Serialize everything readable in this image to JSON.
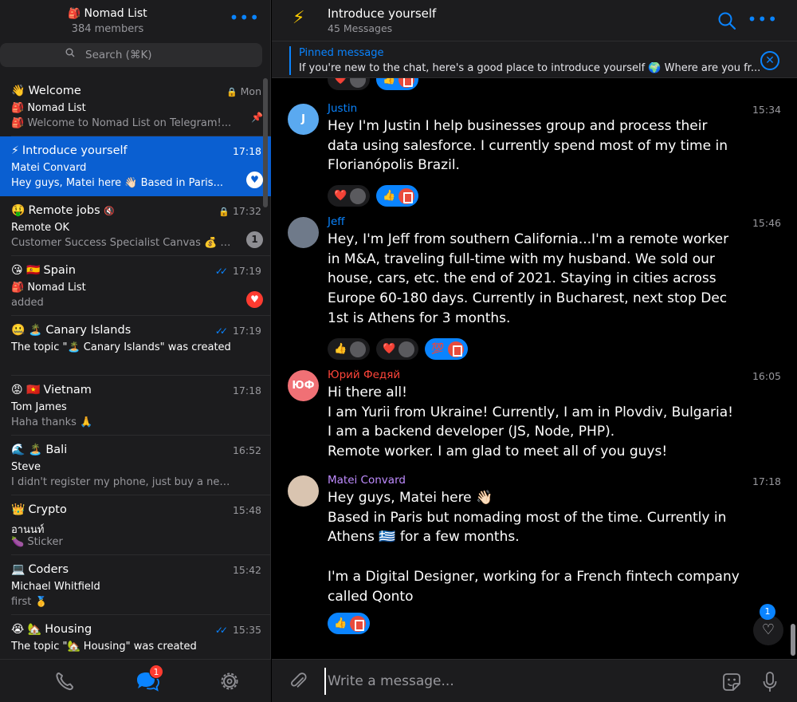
{
  "group": {
    "icon": "backpack-icon",
    "title": "Nomad List",
    "members": "384 members"
  },
  "search": {
    "placeholder": "Search (⌘K)"
  },
  "chats": [
    {
      "emoji": "👋",
      "name": "Welcome",
      "time": "Mon",
      "locked": true,
      "line2": "🎒 Nomad List",
      "line3": "🎒 Welcome to Nomad List on Telegram!...",
      "side": "pin"
    },
    {
      "emoji": "⚡",
      "name": "Introduce yourself",
      "time": "17:18",
      "active": true,
      "line2": "Matei Convard",
      "line3": "Hey guys, Matei here 👋🏻 Based in Paris...",
      "side": "heart-white"
    },
    {
      "emoji": "🤑",
      "name": "Remote jobs",
      "muted": true,
      "time": "17:32",
      "locked": true,
      "line2": "Remote OK",
      "line3": "Customer Success Specialist Canvas 💰 ~$...",
      "side": "count",
      "count": "1"
    },
    {
      "emoji": "😘 🇪🇸",
      "name": "Spain",
      "time": "17:19",
      "read": true,
      "line2": "🎒 Nomad List",
      "line3": "added",
      "side": "heart-red"
    },
    {
      "emoji": "🤐 🏝️",
      "name": "Canary Islands",
      "time": "17:19",
      "read": true,
      "line2": "The topic \"🏝️ Canary Islands\" was created",
      "line3": ""
    },
    {
      "emoji": "😡 🇻🇳",
      "name": "Vietnam",
      "time": "17:18",
      "line2": "Tom James",
      "line3": "Haha thanks 🙏"
    },
    {
      "emoji": "🌊 🏝️",
      "name": "Bali",
      "time": "16:52",
      "line2": "Steve",
      "line3": "I didn't register my phone, just buy a new sim c..."
    },
    {
      "emoji": "👑",
      "name": "Crypto",
      "time": "15:48",
      "line2": "อานนท์",
      "line3": "🍆 Sticker"
    },
    {
      "emoji": "💻",
      "name": "Coders",
      "time": "15:42",
      "line2": "Michael Whitfield",
      "line3": "first 🥇"
    },
    {
      "emoji": "😭 🏡",
      "name": "Housing",
      "time": "15:35",
      "read": true,
      "line2": "The topic \"🏡 Housing\" was created",
      "line3": ""
    }
  ],
  "tabbar": {
    "chats_badge": "1"
  },
  "topic": {
    "icon": "lightning-icon",
    "title": "Introduce yourself",
    "subtitle": "45 Messages"
  },
  "pinned": {
    "title": "Pinned message",
    "text": "If you're new to the chat, here's a good place to introduce yourself  🌍  Where are you fr..."
  },
  "messages": [
    {
      "sender": "Justin",
      "sender_color": "#0a84ff",
      "time": "15:34",
      "avatar_initials": "J",
      "avatar_color": "#5aa9f0",
      "text": "Hey I'm Justin I help businesses group and process their data using salesforce. I currently spend most of my time in Florianópolis Brazil.",
      "reactions": [
        {
          "emoji": "❤️",
          "mine": false
        },
        {
          "emoji": "👍",
          "mine": true
        }
      ]
    },
    {
      "sender": "Jeff",
      "sender_color": "#0a84ff",
      "time": "15:46",
      "avatar_initials": "",
      "avatar_color": "#6f7a8a",
      "text": "Hey, I'm Jeff from southern California...I'm a remote worker in M&A,  traveling full-time with my husband. We sold our house, cars, etc. the end of 2021. Staying in cities across Europe 60-180 days. Currently in Bucharest, next stop Dec 1st is Athens for 3 months.",
      "reactions": [
        {
          "emoji": "👍",
          "mine": false
        },
        {
          "emoji": "❤️",
          "mine": false
        },
        {
          "emoji": "💯",
          "mine": true
        }
      ]
    },
    {
      "sender": "Юрий Федяй",
      "sender_color": "#ff453a",
      "time": "16:05",
      "avatar_initials": "ЮФ",
      "avatar_color": "#f07075",
      "text": "Hi there all!\n I am Yurii from Ukraine! Currently, I am in Plovdiv, Bulgaria!\nI am a backend developer (JS, Node, PHP).\nRemote worker. I am glad to meet all of you guys!",
      "reactions": []
    },
    {
      "sender": "Matei Convard",
      "sender_color": "#bf8cff",
      "time": "17:18",
      "avatar_initials": "",
      "avatar_color": "#d9c4b0",
      "text": "Hey guys, Matei here 👋🏻\nBased in Paris but nomading most of the time. Currently in Athens 🇬🇷  for a few months.\n\nI'm a Digital Designer, working for a French fintech company called Qonto",
      "reactions": [
        {
          "emoji": "👍",
          "mine": true
        }
      ]
    }
  ],
  "partial_reactions": [
    {
      "emoji": "❤️"
    },
    {
      "emoji": "👍"
    }
  ],
  "unread_reactions": "1",
  "composer": {
    "placeholder": "Write a message..."
  }
}
